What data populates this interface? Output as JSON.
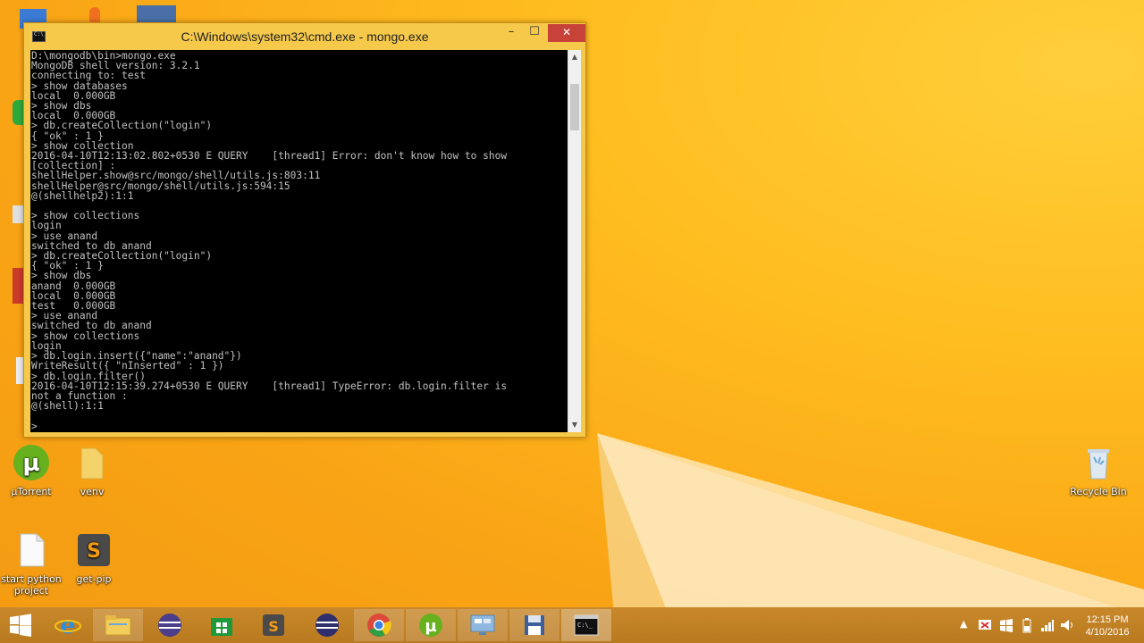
{
  "window": {
    "title": "C:\\Windows\\system32\\cmd.exe - mongo.exe",
    "minimize": "–",
    "maximize": "☐",
    "close": "✕"
  },
  "console": {
    "lines": [
      "D:\\mongodb\\bin>mongo.exe",
      "MongoDB shell version: 3.2.1",
      "connecting to: test",
      "> show databases",
      "local  0.000GB",
      "> show dbs",
      "local  0.000GB",
      "> db.createCollection(\"login\")",
      "{ \"ok\" : 1 }",
      "> show collection",
      "2016-04-10T12:13:02.802+0530 E QUERY    [thread1] Error: don't know how to show",
      "[collection] :",
      "shellHelper.show@src/mongo/shell/utils.js:803:11",
      "shellHelper@src/mongo/shell/utils.js:594:15",
      "@(shellhelp2):1:1",
      "",
      "> show collections",
      "login",
      "> use anand",
      "switched to db anand",
      "> db.createCollection(\"login\")",
      "{ \"ok\" : 1 }",
      "> show dbs",
      "anand  0.000GB",
      "local  0.000GB",
      "test   0.000GB",
      "> use anand",
      "switched to db anand",
      "> show collections",
      "login",
      "> db.login.insert({\"name\":\"anand\"})",
      "WriteResult({ \"nInserted\" : 1 })",
      "> db.login.filter()",
      "2016-04-10T12:15:39.274+0530 E QUERY    [thread1] TypeError: db.login.filter is",
      "not a function :",
      "@(shell):1:1",
      "",
      ">"
    ]
  },
  "desktop_icons": [
    {
      "label": "µTorrent",
      "icon": "utorrent-icon"
    },
    {
      "label": "venv",
      "icon": "folder-icon"
    },
    {
      "label": "start python project",
      "icon": "file-icon"
    },
    {
      "label": "get-pip",
      "icon": "sublime-file-icon"
    },
    {
      "label": "Recycle Bin",
      "icon": "recycle-bin-icon"
    }
  ],
  "taskbar": {
    "items": [
      "start-icon",
      "internet-explorer-icon",
      "file-explorer-icon",
      "eclipse-icon",
      "store-icon",
      "sublime-text-icon",
      "eclipse-icon",
      "chrome-icon",
      "utorrent-icon",
      "remote-desktop-icon",
      "floppy-icon",
      "cmd-icon"
    ],
    "clock_time": "12:15 PM",
    "clock_date": "4/10/2016"
  },
  "colors": {
    "accent": "#f6c94a",
    "close": "#c7433a",
    "console_bg": "#000000",
    "console_fg": "#c0c0c0"
  }
}
